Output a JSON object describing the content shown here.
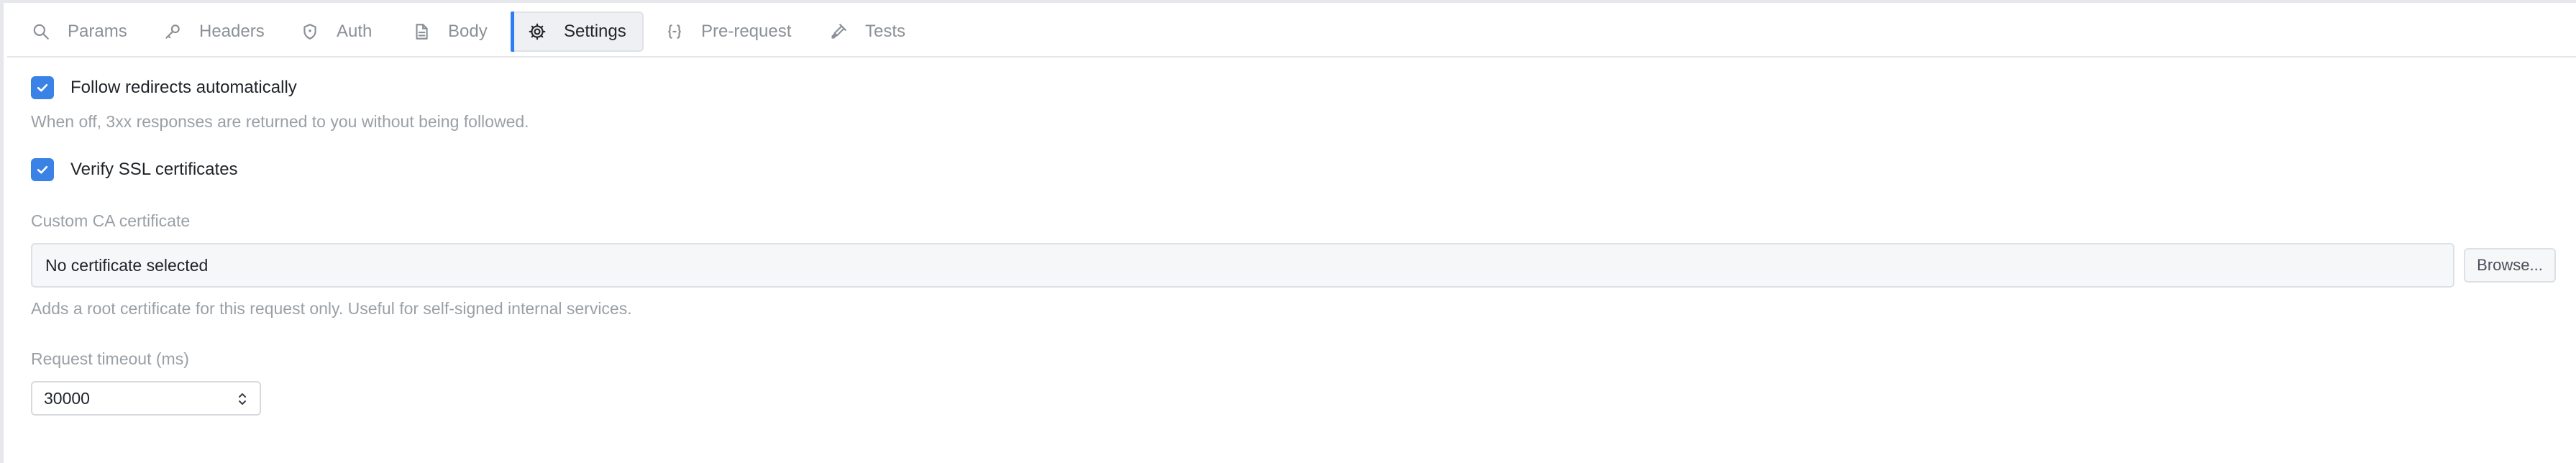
{
  "tabs": [
    {
      "label": "Params",
      "icon": "search-icon"
    },
    {
      "label": "Headers",
      "icon": "key-icon"
    },
    {
      "label": "Auth",
      "icon": "shield-icon"
    },
    {
      "label": "Body",
      "icon": "document-icon"
    },
    {
      "label": "Settings",
      "icon": "gear-icon",
      "active": true
    },
    {
      "label": "Pre-request",
      "icon": "braces-icon"
    },
    {
      "label": "Tests",
      "icon": "flask-icon"
    }
  ],
  "settings": {
    "follow_redirects": {
      "label": "Follow redirects automatically",
      "checked": true,
      "helper": "When off, 3xx responses are returned to you without being followed."
    },
    "verify_ssl": {
      "label": "Verify SSL certificates",
      "checked": true
    },
    "custom_ca": {
      "label": "Custom CA certificate",
      "value": "No certificate selected",
      "browse_label": "Browse...",
      "helper": "Adds a root certificate for this request only. Useful for self-signed internal services."
    },
    "timeout": {
      "label": "Request timeout (ms)",
      "value": "30000"
    }
  },
  "colors": {
    "accent": "#3b82e6",
    "active_indicator": "#2f7df6"
  }
}
